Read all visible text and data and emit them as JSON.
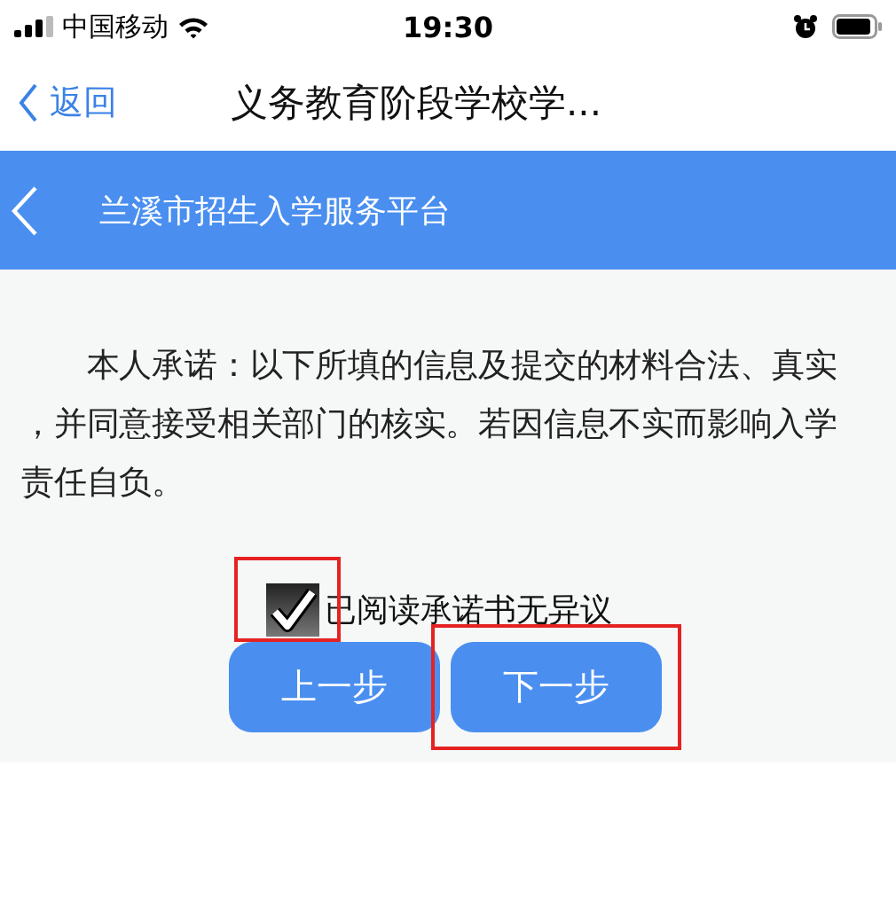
{
  "status_bar": {
    "carrier": "中国移动",
    "time": "19:30"
  },
  "nav_bar": {
    "back_label": "返回",
    "title": "义务教育阶段学校学..."
  },
  "header": {
    "title": "兰溪市招生入学服务平台"
  },
  "pledge": {
    "text": "本人承诺：以下所填的信息及提交的材料合法、真实，并同意接受相关部门的核实。若因信息不实而影响入学责任自负。"
  },
  "agreement": {
    "label": "已阅读承诺书无异议",
    "checked": true
  },
  "buttons": [
    {
      "label": "上一步",
      "kind": "prev"
    },
    {
      "label": "下一步",
      "kind": "next"
    }
  ]
}
